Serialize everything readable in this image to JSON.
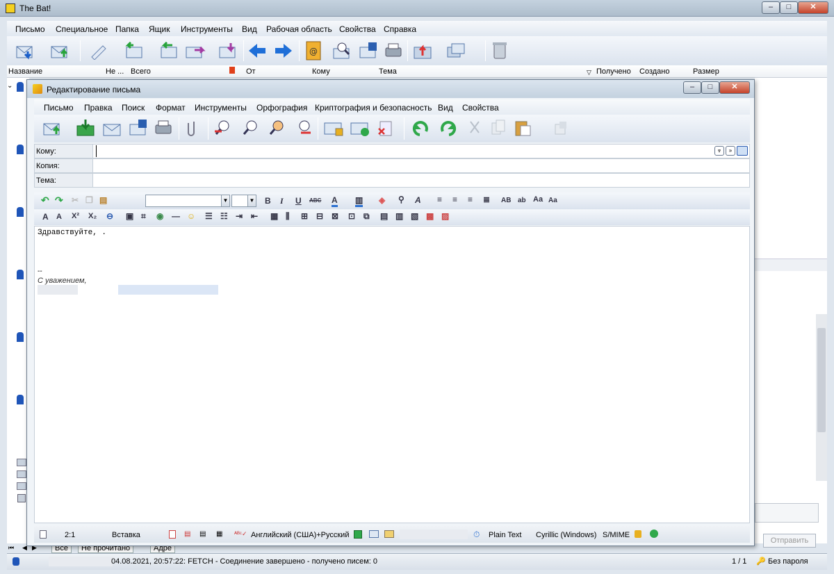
{
  "app": {
    "title": "The Bat!"
  },
  "main_menu": [
    "Письмо",
    "Специальное",
    "Папка",
    "Ящик",
    "Инструменты",
    "Вид",
    "Рабочая область",
    "Свойства",
    "Справка"
  ],
  "columns": {
    "name": "Название",
    "unread": "Не ...",
    "total": "Всего",
    "from": "От",
    "to": "Кому",
    "subject": "Тема",
    "received": "Получено",
    "created": "Создано",
    "size": "Размер"
  },
  "tabs": {
    "all": "Все",
    "unread": "Не прочитано",
    "addr": "Адре"
  },
  "status": {
    "log": "04.08.2021, 20:57:22: FETCH - Соединение завершено - получено писем: 0",
    "pages": "1 / 1",
    "password": "Без пароля",
    "send": "Отправить"
  },
  "compose": {
    "title": "Редактирование письма",
    "menu": [
      "Письмо",
      "Правка",
      "Поиск",
      "Формат",
      "Инструменты",
      "Орфография",
      "Криптография и безопасность",
      "Вид",
      "Свойства"
    ],
    "to_label": "Кому:",
    "cc_label": "Копия:",
    "subject_label": "Тема:",
    "to_value": "",
    "cc_value": "",
    "subject_value": "",
    "body_greeting": "Здравствуйте, .",
    "body_sig_sep": "--",
    "body_sig": "С уважением,",
    "status": {
      "position": "2:1",
      "mode": "Вставка",
      "language": "Английский (США)+Русский",
      "format": "Plain Text",
      "charset": "Cyrillic (Windows)",
      "smime": "S/MIME"
    }
  },
  "colors": {
    "accent": "#2a6fd1",
    "title_bar": "#c3d1df",
    "toolbar": "#dbe3ee"
  }
}
